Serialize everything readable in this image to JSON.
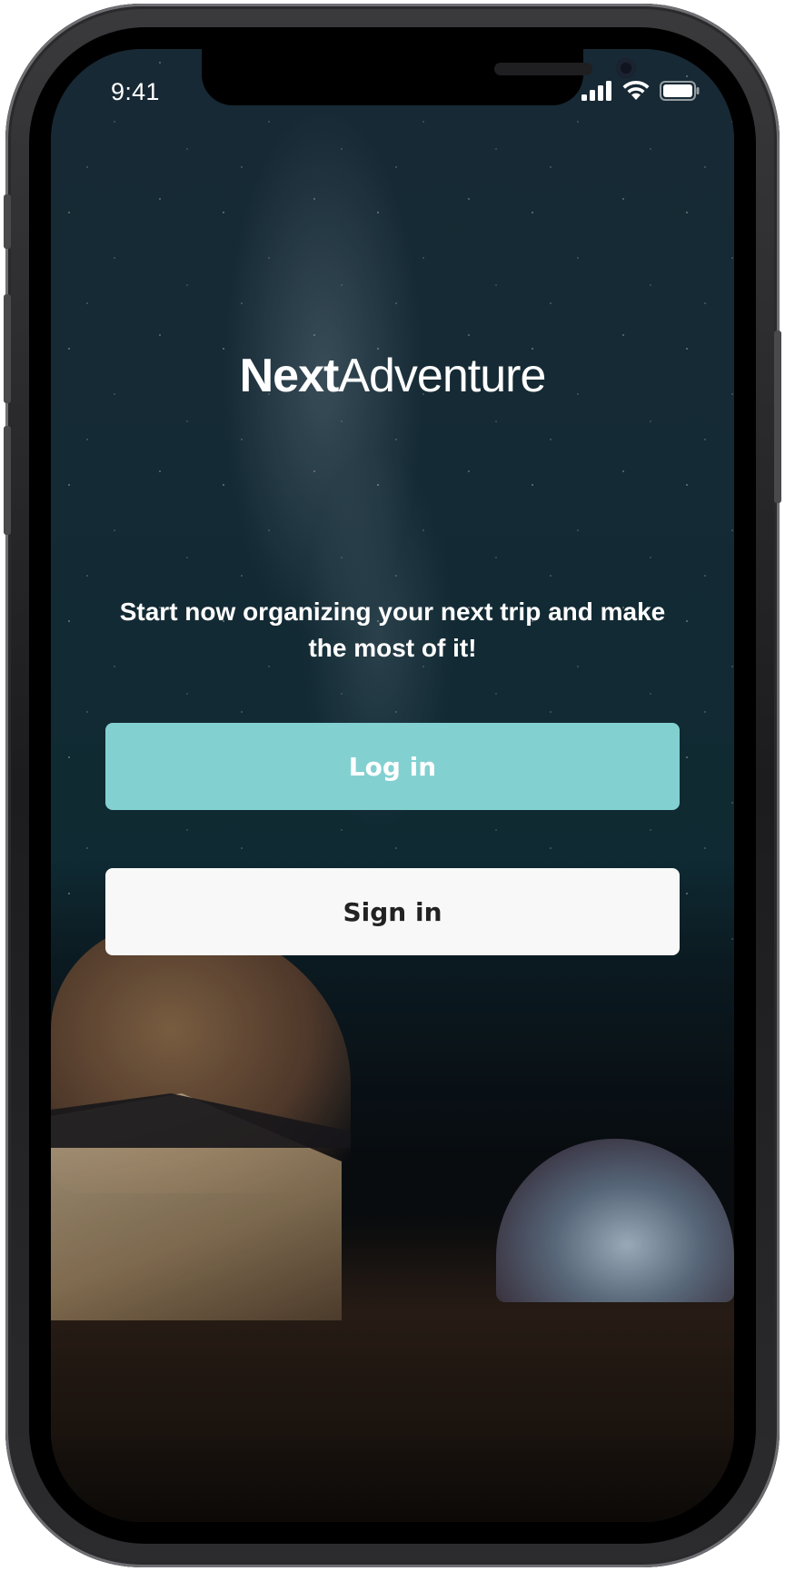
{
  "status_bar": {
    "time": "9:41",
    "icons": [
      "cellular-signal-icon",
      "wifi-icon",
      "battery-icon"
    ]
  },
  "brand": {
    "name_bold": "Next",
    "name_light": "Adventure"
  },
  "tagline": "Start now organizing your next trip and make the most of it!",
  "buttons": {
    "login_label": "Log in",
    "signin_label": "Sign in"
  },
  "colors": {
    "login_button": "#83d0d1",
    "signin_button": "#f8f8f8",
    "text_light": "#ffffff",
    "text_dark": "#222222"
  }
}
